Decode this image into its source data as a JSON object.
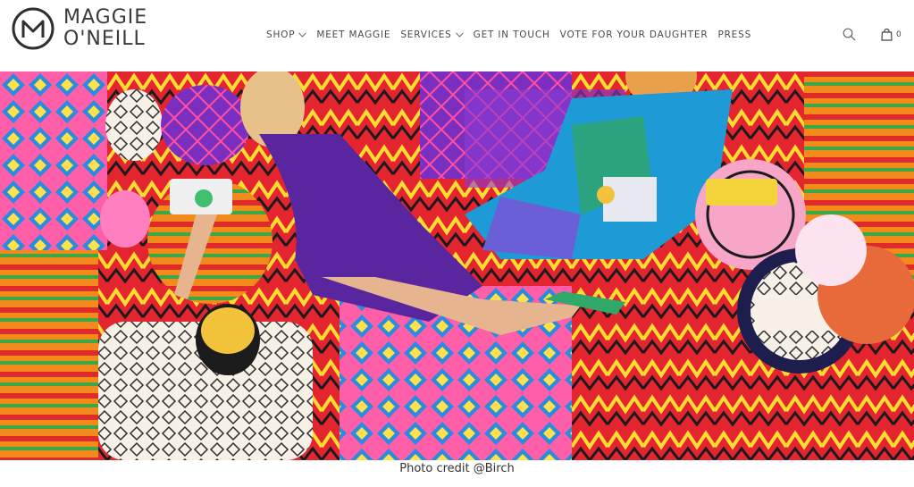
{
  "brand": {
    "line1": "MAGGIE",
    "line2": "O'NEILL",
    "logo_icon": "m-circle-logo"
  },
  "nav": {
    "items": [
      {
        "label": "SHOP",
        "has_dropdown": true
      },
      {
        "label": "MEET MAGGIE",
        "has_dropdown": false
      },
      {
        "label": "SERVICES",
        "has_dropdown": true
      },
      {
        "label": "GET IN TOUCH",
        "has_dropdown": false
      },
      {
        "label": "VOTE FOR YOUR DAUGHTER",
        "has_dropdown": false
      },
      {
        "label": "PRESS",
        "has_dropdown": false
      }
    ]
  },
  "header_icons": {
    "search_icon": "search-icon",
    "cart_icon": "shopping-bag-icon",
    "cart_count": "0"
  },
  "hero": {
    "description_colors": [
      "#e4252f",
      "#6b2fa3",
      "#f2b21c",
      "#ff5fa8",
      "#1e9ad6",
      "#f8f3ea"
    ]
  },
  "caption": {
    "text": "Photo credit @Birch"
  }
}
